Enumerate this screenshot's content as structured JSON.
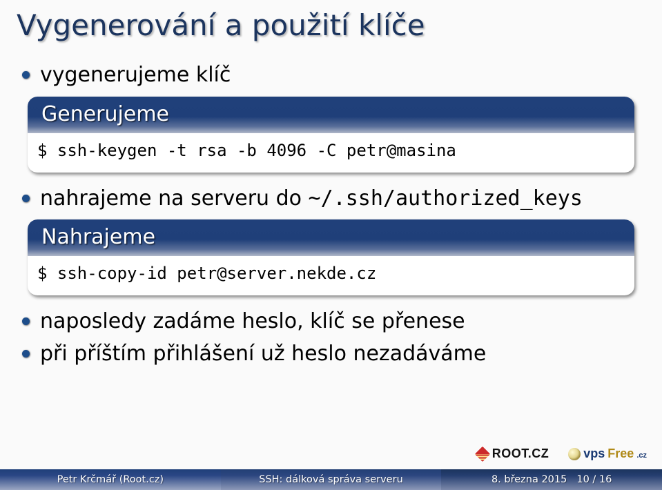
{
  "title": "Vygenerování a použití klíče",
  "content": {
    "bullet1": "vygenerujeme klíč",
    "block1": {
      "head": "Generujeme",
      "body": "$ ssh-keygen -t rsa -b 4096 -C petr@masina"
    },
    "bullet2_pre": "nahrajeme na serveru do ",
    "bullet2_code": "~/.ssh/authorized_keys",
    "block2": {
      "head": "Nahrajeme",
      "body": "$ ssh-copy-id petr@server.nekde.cz"
    },
    "bullet3": "naposledy zadáme heslo, klíč se přenese",
    "bullet4": "při příštím přihlášení už heslo nezadáváme"
  },
  "logos": {
    "root": "ROOT.CZ",
    "vps_a": "vps",
    "vps_b": "Free",
    "vps_c": ".cz"
  },
  "footer": {
    "author": "Petr Krčmář (Root.cz)",
    "talk": "SSH: dálková správa serveru",
    "date": "8. března 2015",
    "page": "10 / 16"
  }
}
